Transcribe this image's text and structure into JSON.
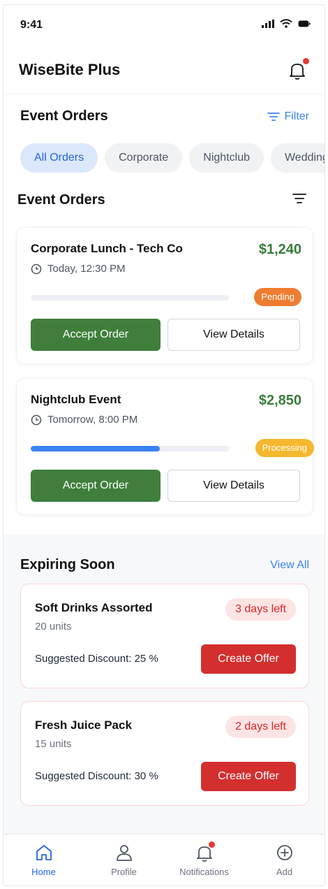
{
  "status_bar": {
    "time": "9:41"
  },
  "header": {
    "title": "WiseBite Plus"
  },
  "event_orders_section": {
    "title": "Event Orders",
    "filter_label": "Filter",
    "chips": [
      "All Orders",
      "Corporate",
      "Nightclub",
      "Wedding"
    ],
    "active_chip": "All Orders"
  },
  "orders_list": {
    "title": "Event Orders",
    "orders": [
      {
        "title": "Corporate Lunch - Tech Co",
        "amount": "$1,240",
        "time": "Today, 12:30 PM",
        "progress": 0,
        "status": "Pending",
        "accept_label": "Accept Order",
        "view_label": "View Details"
      },
      {
        "title": "Nightclub Event",
        "amount": "$2,850",
        "time": "Tomorrow, 8:00 PM",
        "progress": 0.65,
        "status": "Processing",
        "accept_label": "Accept Order",
        "view_label": "View Details"
      }
    ]
  },
  "expiring": {
    "title": "Expiring Soon",
    "view_all_label": "View All",
    "items": [
      {
        "name": "Soft Drinks Assorted",
        "units": "20 units",
        "days_left": "3 days left",
        "discount": "Suggested Discount: 25 %",
        "action_label": "Create Offer"
      },
      {
        "name": "Fresh Juice Pack",
        "units": "15 units",
        "days_left": "2 days left",
        "discount": "Suggested Discount: 30 %",
        "action_label": "Create Offer"
      }
    ]
  },
  "bottom_nav": {
    "items": [
      {
        "label": "Home",
        "icon": "home-icon"
      },
      {
        "label": "Profile",
        "icon": "user-icon"
      },
      {
        "label": "Notifications",
        "icon": "bell-icon"
      },
      {
        "label": "Add",
        "icon": "plus-circle-icon"
      }
    ],
    "active": "Home"
  },
  "colors": {
    "accent_blue": "#3b82f6",
    "accept_green": "#3f7f3b",
    "amount_green": "#3a7d3a",
    "pending_orange": "#ef7d2f",
    "processing_yellow": "#f5b82e",
    "danger_red": "#d32f2f"
  }
}
